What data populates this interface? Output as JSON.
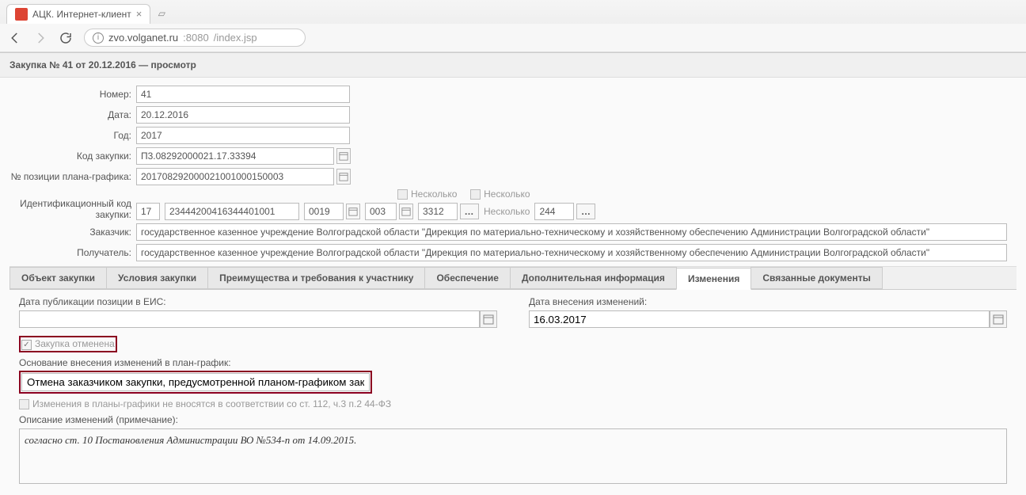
{
  "browser": {
    "tab_title": "АЦК. Интернет-клиент",
    "url_host": "zvo.volganet.ru",
    "url_port": ":8080",
    "url_path": "/index.jsp"
  },
  "header": {
    "title": "Закупка № 41 от 20.12.2016 — просмотр"
  },
  "fields": {
    "number": {
      "label": "Номер:",
      "value": "41"
    },
    "date": {
      "label": "Дата:",
      "value": "20.12.2016"
    },
    "year": {
      "label": "Год:",
      "value": "2017"
    },
    "code": {
      "label": "Код закупки:",
      "value": "П3.08292000021.17.33394"
    },
    "plan_pos": {
      "label": "№ позиции плана-графика:",
      "value": "201708292000021001000150003"
    },
    "idcode_label": "Идентификационный код закупки:",
    "idcode": {
      "p1": "17",
      "p2": "23444200416344401001",
      "p3": "0019",
      "p4": "003",
      "p5": "3312",
      "p6": "244"
    },
    "several1": "Несколько",
    "several2": "Несколько",
    "customer": {
      "label": "Заказчик:",
      "value": "государственное казенное учреждение Волгоградской области \"Дирекция по материально-техническому и хозяйственному обеспечению Администрации Волгоградской области\""
    },
    "recipient": {
      "label": "Получатель:",
      "value": "государственное казенное учреждение Волгоградской области \"Дирекция по материально-техническому и хозяйственному обеспечению Администрации Волгоградской области\""
    }
  },
  "tabs": [
    "Объект закупки",
    "Условия закупки",
    "Преимущества и требования к участнику",
    "Обеспечение",
    "Дополнительная информация",
    "Изменения",
    "Связанные документы"
  ],
  "changes": {
    "pub_date_label": "Дата публикации позиции в ЕИС:",
    "pub_date_value": "",
    "change_date_label": "Дата внесения изменений:",
    "change_date_value": "16.03.2017",
    "cancel_label": "Закупка отменена",
    "basis_label": "Основание внесения изменений в план-график:",
    "basis_value": "Отмена заказчиком закупки, предусмотренной планом-графиком закупок",
    "no_changes_label": "Изменения в планы-графики не вносятся в соответствии со ст. 112, ч.3 п.2 44-ФЗ",
    "desc_label": "Описание изменений (примечание):",
    "desc_value": "согласно ст. 10 Постановления Администрации ВО №534-п от 14.09.2015."
  }
}
